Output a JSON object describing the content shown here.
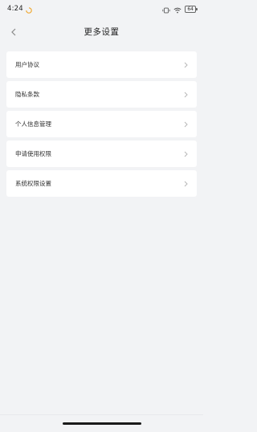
{
  "status_bar": {
    "time": "4:24",
    "battery_level": "64"
  },
  "header": {
    "title": "更多设置",
    "back_icon": "chevron-left-icon"
  },
  "menu": {
    "items": [
      {
        "label": "用户协议",
        "icon": "chevron-right-icon"
      },
      {
        "label": "隐私条款",
        "icon": "chevron-right-icon"
      },
      {
        "label": "个人信息管理",
        "icon": "chevron-right-icon"
      },
      {
        "label": "申请使用权限",
        "icon": "chevron-right-icon"
      },
      {
        "label": "系统权限设置",
        "icon": "chevron-right-icon"
      }
    ]
  },
  "colors": {
    "background": "#f2f3f5",
    "card": "#ffffff",
    "chevron": "#b8b8b8"
  }
}
